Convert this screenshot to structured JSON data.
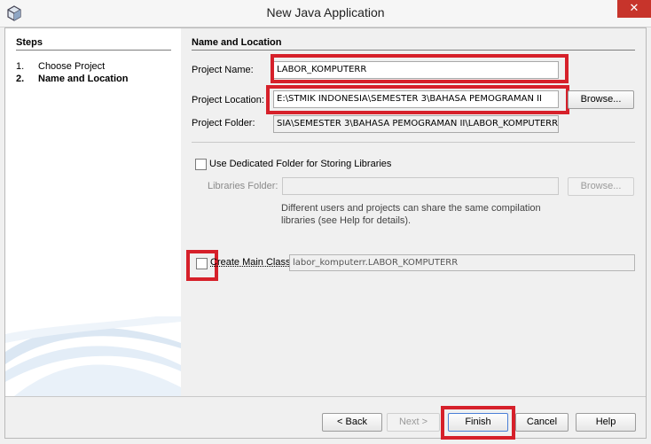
{
  "window": {
    "title": "New Java Application",
    "close_glyph": "✕",
    "icon": "netbeans-cube-icon"
  },
  "steps": {
    "heading": "Steps",
    "items": [
      {
        "num": "1.",
        "label": "Choose Project",
        "current": false
      },
      {
        "num": "2.",
        "label": "Name and Location",
        "current": true
      }
    ]
  },
  "section": {
    "title": "Name and Location"
  },
  "form": {
    "project_name_label": "Project Name:",
    "project_name_value": "LABOR_KOMPUTERR",
    "project_location_label": "Project Location:",
    "project_location_value": "E:\\STMIK INDONESIA\\SEMESTER 3\\BAHASA PEMOGRAMAN II",
    "browse_label": "Browse...",
    "project_folder_label": "Project Folder:",
    "project_folder_value": "SIA\\SEMESTER 3\\BAHASA PEMOGRAMAN II\\LABOR_KOMPUTERR",
    "dedicated_folder_label": "Use Dedicated Folder for Storing Libraries",
    "libraries_folder_label": "Libraries Folder:",
    "libraries_folder_value": "",
    "libraries_browse_label": "Browse...",
    "help_text_line1": "Different users and projects can share the same compilation",
    "help_text_line2": "libraries (see Help for details).",
    "main_class_label": "Create Main Class",
    "main_class_value": "labor_komputerr.LABOR_KOMPUTERR"
  },
  "buttons": {
    "back": "< Back",
    "next": "Next >",
    "finish": "Finish",
    "cancel": "Cancel",
    "help": "Help"
  },
  "colors": {
    "highlight": "#d6202a",
    "close": "#c7342b"
  }
}
